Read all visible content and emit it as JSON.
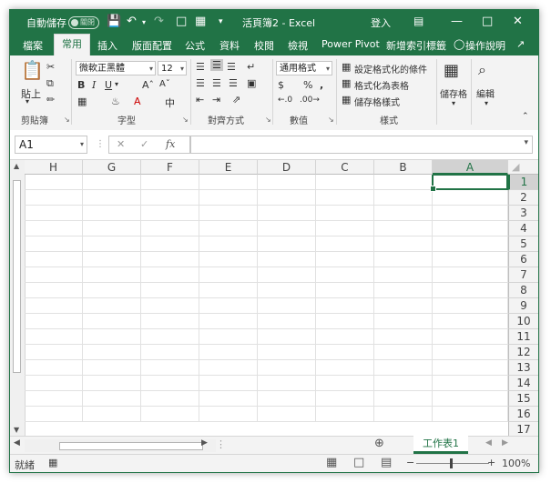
{
  "titlebar": {
    "autosave_label": "自動儲存",
    "autosave_state": "關閉",
    "title": "活頁簿2 - Excel",
    "signin": "登入"
  },
  "tabs": [
    "檔案",
    "常用",
    "插入",
    "版面配置",
    "公式",
    "資料",
    "校閱",
    "檢視",
    "Power Pivot",
    "新增索引標籤"
  ],
  "tell_me": "操作說明",
  "ribbon": {
    "clipboard": {
      "paste": "貼上",
      "label": "剪貼簿"
    },
    "font": {
      "name": "微軟正黑體",
      "size": "12",
      "label": "字型"
    },
    "alignment": {
      "label": "對齊方式"
    },
    "number": {
      "format": "通用格式",
      "label": "數值"
    },
    "styles": {
      "conditional": "設定格式化的條件",
      "table": "格式化為表格",
      "cell": "儲存格樣式",
      "label": "樣式"
    },
    "cells": {
      "label": "儲存格"
    },
    "editing": {
      "label": "編輯"
    }
  },
  "formula_bar": {
    "name_box": "A1",
    "formula": ""
  },
  "columns": [
    "H",
    "G",
    "F",
    "E",
    "D",
    "C",
    "B",
    "A"
  ],
  "rows": [
    "1",
    "2",
    "3",
    "4",
    "5",
    "6",
    "7",
    "8",
    "9",
    "10",
    "11",
    "12",
    "13",
    "14",
    "15",
    "16",
    "17"
  ],
  "selected_cell": "A1",
  "sheet_tab": "工作表1",
  "status": {
    "ready": "就緒",
    "zoom": "100%"
  },
  "colors": {
    "accent": "#217346"
  }
}
